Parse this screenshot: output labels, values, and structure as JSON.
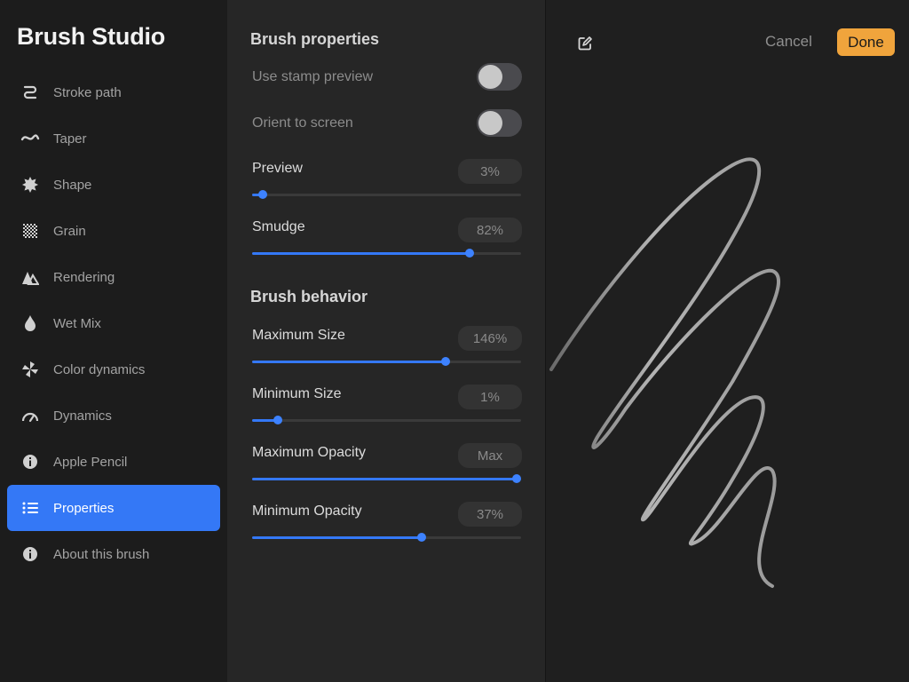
{
  "app": {
    "title": "Brush Studio"
  },
  "sidebar": {
    "items": [
      {
        "label": "Stroke path",
        "icon": "stroke-path-icon"
      },
      {
        "label": "Taper",
        "icon": "taper-icon"
      },
      {
        "label": "Shape",
        "icon": "shape-icon"
      },
      {
        "label": "Grain",
        "icon": "grain-icon"
      },
      {
        "label": "Rendering",
        "icon": "rendering-icon"
      },
      {
        "label": "Wet Mix",
        "icon": "wet-mix-icon"
      },
      {
        "label": "Color dynamics",
        "icon": "color-dynamics-icon"
      },
      {
        "label": "Dynamics",
        "icon": "dynamics-icon"
      },
      {
        "label": "Apple Pencil",
        "icon": "apple-pencil-icon"
      },
      {
        "label": "Properties",
        "icon": "properties-icon",
        "active": true
      },
      {
        "label": "About this brush",
        "icon": "about-icon"
      }
    ]
  },
  "properties": {
    "brush_properties_title": "Brush properties",
    "use_stamp_preview": {
      "label": "Use stamp preview",
      "on": false
    },
    "orient_to_screen": {
      "label": "Orient to screen",
      "on": false
    },
    "preview": {
      "label": "Preview",
      "value": "3%",
      "fraction": 0.04
    },
    "smudge": {
      "label": "Smudge",
      "value": "82%",
      "fraction": 0.81
    },
    "brush_behavior_title": "Brush behavior",
    "max_size": {
      "label": "Maximum Size",
      "value": "146%",
      "fraction": 0.72
    },
    "min_size": {
      "label": "Minimum Size",
      "value": "1%",
      "fraction": 0.095
    },
    "max_opacity": {
      "label": "Maximum Opacity",
      "value": "Max",
      "fraction": 0.985
    },
    "min_opacity": {
      "label": "Minimum Opacity",
      "value": "37%",
      "fraction": 0.63
    }
  },
  "drawing_pad": {
    "cancel_label": "Cancel",
    "done_label": "Done",
    "edit_icon": "edit-icon"
  },
  "colors": {
    "accent": "#3478f6",
    "done": "#f0a43c",
    "background": "#1c1c1c"
  }
}
